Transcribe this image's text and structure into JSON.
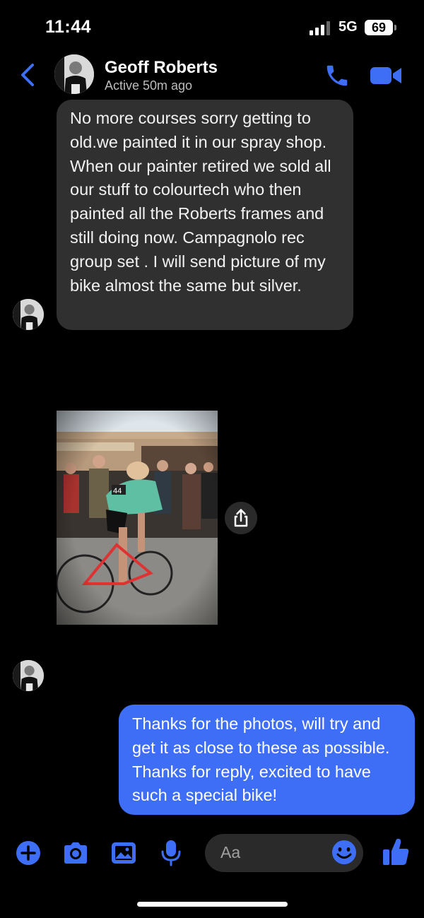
{
  "status_bar": {
    "time": "11:44",
    "network": "5G",
    "battery": "69"
  },
  "header": {
    "name": "Geoff Roberts",
    "status": "Active 50m ago"
  },
  "messages": {
    "incoming_text": "No more courses sorry getting to old.we painted it in our spray shop. When our painter retired we sold all our stuff to colourtech who then painted all the Roberts frames and still doing now. Campagnolo rec group set . I will send picture of my bike almost the same but silver.",
    "outgoing_text": "Thanks for the photos, will try and get it as close to these as possible. Thanks for reply, excited to have such a special bike!"
  },
  "composer": {
    "placeholder": "Aa"
  },
  "icons": {
    "back": "chevron-left-icon",
    "call": "phone-icon",
    "video": "video-camera-icon",
    "share": "share-icon",
    "plus": "plus-icon",
    "camera": "camera-icon",
    "gallery": "image-icon",
    "mic": "microphone-icon",
    "emoji": "smiley-icon",
    "like": "thumbs-up-icon"
  },
  "colors": {
    "accent": "#3e6ef5",
    "incoming_bubble": "#303030",
    "background": "#000000"
  }
}
